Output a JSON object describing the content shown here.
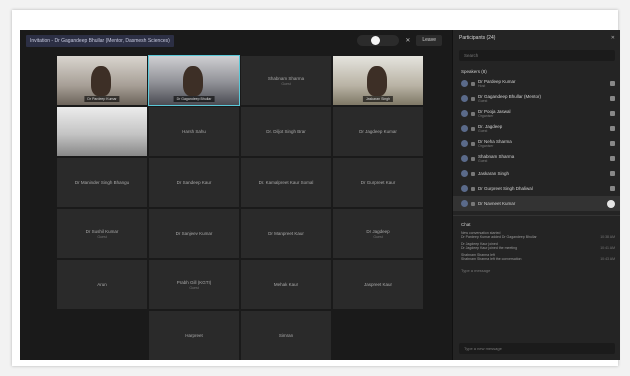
{
  "meeting": {
    "title": "Invitation - Dr Gagandeep Bhullar (Mentor, Dasmesh Sciences)",
    "leave_label": "Leave"
  },
  "tiles": [
    {
      "name": "Dr Pardeep Kumar",
      "sub": "",
      "video": true,
      "bg": 1
    },
    {
      "name": "Dr Gagandeep Bhullar",
      "sub": "",
      "video": true,
      "bg": 2,
      "active": true
    },
    {
      "name": "Shabnam Sharma",
      "sub": "Guest",
      "video": false
    },
    {
      "name": "Jaskaran Singh",
      "sub": "",
      "video": true,
      "bg": 3
    },
    {
      "name": "",
      "sub": "",
      "video": true,
      "bg": 4
    },
    {
      "name": "Harsh Sahu",
      "sub": "",
      "video": false
    },
    {
      "name": "Dr. Diljot Singh Brar",
      "sub": "",
      "video": false
    },
    {
      "name": "Dr Jagdeep Kumar",
      "sub": "",
      "video": false
    },
    {
      "name": "Dr Maninder Singh Bhangu",
      "sub": "",
      "video": false
    },
    {
      "name": "Dr Sandeep Kaur",
      "sub": "",
      "video": false
    },
    {
      "name": "Dr. Kamalpreet Kaur Somal",
      "sub": "",
      "video": false
    },
    {
      "name": "Dr Gurpreet Kaur",
      "sub": "",
      "video": false
    },
    {
      "name": "Dr Sushil Kumar",
      "sub": "Guest",
      "video": false
    },
    {
      "name": "Dr Sanjeev Kumar",
      "sub": "",
      "video": false
    },
    {
      "name": "Dr Manpreet Kaur",
      "sub": "",
      "video": false
    },
    {
      "name": "Dr Jagdeep",
      "sub": "Guest",
      "video": false
    },
    {
      "name": "Arun",
      "sub": "",
      "video": false
    },
    {
      "name": "Prabh Gill (KGTI)",
      "sub": "Guest",
      "video": false
    },
    {
      "name": "Mehak Kaur",
      "sub": "",
      "video": false
    },
    {
      "name": "Jaspreet Kaur",
      "sub": "",
      "video": false
    },
    {
      "name": "Harpreet",
      "sub": "",
      "video": false,
      "col": 2
    },
    {
      "name": "Simran",
      "sub": "",
      "video": false
    }
  ],
  "sidebar": {
    "title": "Participants (24)",
    "search_placeholder": "Search",
    "section_label": "Speakers (8)",
    "participants": [
      {
        "name": "Dr Pardeep Kumar",
        "role": "Host"
      },
      {
        "name": "Dr Gagandeep Bhullar (Mentor)",
        "role": "Guest"
      },
      {
        "name": "Dr Pooja Jaswal",
        "role": "Organiser"
      },
      {
        "name": "Dr. Jagdeep",
        "role": "Guest"
      },
      {
        "name": "Dr Neha Sharma",
        "role": "Organiser"
      },
      {
        "name": "Shabnam Sharma",
        "role": "Guest"
      },
      {
        "name": "Jaskaran Singh",
        "role": ""
      },
      {
        "name": "Dr Gurpreet Singh Dhaliwal",
        "role": ""
      },
      {
        "name": "Dr Navneet Kumar",
        "role": "",
        "selected": true
      }
    ],
    "chat_title": "Chat",
    "chat_messages": [
      {
        "title": "New conversation started",
        "text": "Dr Pardeep Kumar added Dr Gagandeep Bhullar",
        "time": "10:38 AM"
      },
      {
        "title": "Dr Jagdeep Kaur joined",
        "text": "Dr Jagdeep Kaur joined the meeting",
        "time": "10:41 AM"
      },
      {
        "title": "Shabnam Sharma left",
        "text": "Shabnam Sharma left the conversation",
        "time": "10:43 AM"
      }
    ],
    "chat_hint": "Type a message",
    "chat_placeholder": "Type a new message"
  }
}
